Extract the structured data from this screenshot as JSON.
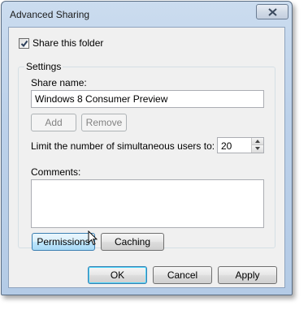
{
  "window": {
    "title": "Advanced Sharing"
  },
  "share": {
    "checkbox_label": "Share this folder",
    "checked": true
  },
  "settings": {
    "group_label": "Settings",
    "share_name_label": "Share name:",
    "share_name_value": "Windows 8 Consumer Preview",
    "add_label": "Add",
    "remove_label": "Remove",
    "limit_label": "Limit the number of simultaneous users to:",
    "limit_value": "20",
    "comments_label": "Comments:",
    "comments_value": "",
    "permissions_label": "Permissions",
    "caching_label": "Caching"
  },
  "footer": {
    "ok_label": "OK",
    "cancel_label": "Cancel",
    "apply_label": "Apply"
  },
  "icons": {
    "close": "close-icon",
    "check": "checkmark-icon",
    "spin_up": "arrow-up-icon",
    "spin_down": "arrow-down-icon",
    "cursor": "mouse-pointer-icon"
  }
}
